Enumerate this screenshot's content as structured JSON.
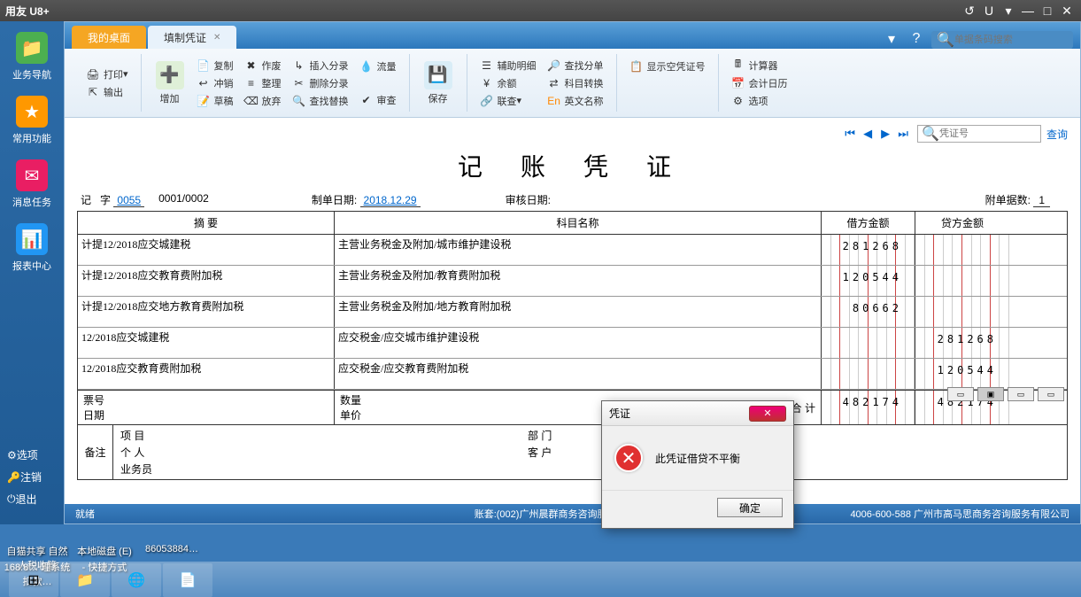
{
  "app": {
    "brand": "用友 U8+"
  },
  "win_controls": {
    "reload": "↺",
    "u": "U",
    "dd": "▾",
    "min": "—",
    "max": "□",
    "close": "✕"
  },
  "tabs": {
    "desktop": "我的桌面",
    "voucher": "填制凭证"
  },
  "topright": {
    "search_ph": "单据条码搜索"
  },
  "leftnav": {
    "biz": "业务导航",
    "fav": "常用功能",
    "msg": "消息任务",
    "rpt": "报表中心",
    "opt": "选项",
    "logout": "注销",
    "exit": "退出"
  },
  "ribbon": {
    "print": "打印",
    "output": "输出",
    "add": "增加",
    "copy": "复制",
    "reverse": "冲销",
    "draft": "草稿",
    "void": "作废",
    "tidy": "整理",
    "abandon": "放弃",
    "insrow": "插入分录",
    "delrow": "删除分录",
    "findrep": "查找替换",
    "flow": "流量",
    "audit": "审查",
    "save": "保存",
    "aux": "辅助明细",
    "bal": "余额",
    "link": "联查",
    "findbill": "查找分单",
    "acctconv": "科目转换",
    "engname": "英文名称",
    "showempty": "显示空凭证号",
    "calc": "计算器",
    "cal": "会计日历",
    "option": "选项"
  },
  "nav": {
    "search_ph": "凭证号",
    "query": "查询"
  },
  "doc": {
    "title": "记 账 凭 证",
    "ji": "记",
    "zi": "字",
    "no": "0055",
    "seq": "0001/0002",
    "make_lbl": "制单日期:",
    "make_date": "2018.12.29",
    "audit_lbl": "审核日期:",
    "attach_lbl": "附单据数:",
    "attach": "1"
  },
  "cols": {
    "summary": "摘 要",
    "account": "科目名称",
    "debit": "借方金额",
    "credit": "贷方金额"
  },
  "rows": [
    {
      "s": "计提12/2018应交城建税",
      "a": "主营业务税金及附加/城市维护建设税",
      "d": "281268",
      "c": ""
    },
    {
      "s": "计提12/2018应交教育费附加税",
      "a": "主营业务税金及附加/教育费附加税",
      "d": "120544",
      "c": ""
    },
    {
      "s": "计提12/2018应交地方教育费附加税",
      "a": "主营业务税金及附加/地方教育附加税",
      "d": "80662",
      "c": ""
    },
    {
      "s": "12/2018应交城建税",
      "a": "应交税金/应交城市维护建设税",
      "d": "",
      "c": "281268"
    },
    {
      "s": "12/2018应交教育费附加税",
      "a": "应交税金/应交教育费附加税",
      "d": "",
      "c": "120544"
    }
  ],
  "sum": {
    "bill": "票号",
    "date": "日期",
    "qty": "数量",
    "price": "单价",
    "total": "合 计",
    "d": "482174",
    "c": "482174"
  },
  "remark": {
    "label": "备注",
    "proj": "项 目",
    "dept": "部 门",
    "person": "个 人",
    "cust": "客 户",
    "staff": "业务员"
  },
  "dialog": {
    "title": "凭证",
    "msg": "此凭证借贷不平衡",
    "ok": "确定"
  },
  "status": {
    "ready": "就绪",
    "book": "账套:(002)广州晨群商务咨询服务有限公…",
    "hotline": "4006-600-588 广州市高马思商务咨询服务有限公司"
  },
  "desktop": {
    "i1": "自猫共享 自然人税收管",
    "i2": "本地磁盘 (E)",
    "i3": "86053884…",
    "i4": "168.8… 理系统扣款…",
    "i5": "- 快捷方式"
  }
}
